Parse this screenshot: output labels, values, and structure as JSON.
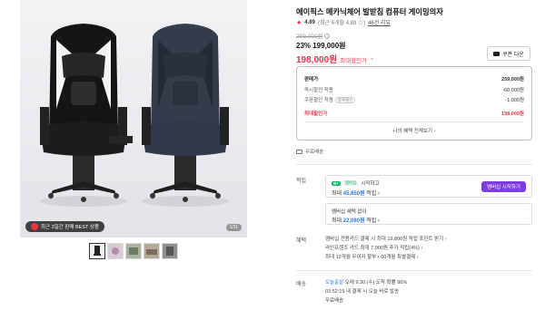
{
  "product": {
    "title": "에이픽스 메카닉체어 발받침 컴퓨터 게이밍의자",
    "rating": "4.89",
    "rating_detail": "(최근 6개월 4.89 ☆)",
    "review_count": "46건 리뷰"
  },
  "gallery": {
    "badge_text": "최근 3일간 판매 BEST 상품",
    "counter": "1/11",
    "thumbnails": [
      "thumb-1",
      "thumb-2",
      "thumb-3",
      "thumb-4",
      "thumb-5"
    ]
  },
  "price": {
    "original": "259,000원",
    "discount_line": "23% 199,000원",
    "final_amount": "198,000원",
    "final_label": "최대할인가",
    "coupon_button": "쿠폰 다운"
  },
  "price_box": {
    "rows": [
      {
        "label": "판매가",
        "value": "259,000원"
      },
      {
        "label": "즉시할인 적용",
        "value": "-60,000원"
      },
      {
        "label": "쿠폰할인 적용",
        "value": "-1,000원"
      },
      {
        "label": "최대할인가",
        "value": "198,000원"
      }
    ],
    "coupon_tag": "중복할인",
    "benefits_link": "나의 혜택 전체보기 ›"
  },
  "shipping": {
    "free": "무료배송"
  },
  "points": {
    "section_label": "적립",
    "npay_badge": "N+",
    "plus_tag": "멤버십",
    "start_text": "시작하고",
    "max_line_prefix": "최대 ",
    "max_amount": "45,850원",
    "max_line_suffix": " 적립 ›",
    "member_button": "멤버십 시작하기",
    "no_member_text": "멤버십 혜택 없이",
    "no_member_prefix": "최대 ",
    "no_member_amount": "22,090원",
    "no_member_suffix": " 적립 ›"
  },
  "benefits": {
    "section_label": "혜택",
    "lines": [
      "멤버십 전용카드 결제 시 최대 19,800원 적립 포인트 받기 ›",
      "라인프렌즈 카드 최대 7,900원 추가 적립(4%) ›",
      "최대 12개월 무이자 할부 • 60개월 특별결제 ›"
    ]
  },
  "delivery": {
    "section_label": "배송",
    "today_label": "오늘출발",
    "line1_rest": " 오래 9.30.(수) 도착 확률 96%",
    "line2": "03:52:19 내 결제 시 오늘 바로 발송",
    "line3": "무료배송"
  },
  "colors": {
    "accent_red": "#e8344a",
    "membership_purple": "#7d3ce0",
    "npay_green": "#11b96a",
    "link_blue": "#2d7be5"
  }
}
